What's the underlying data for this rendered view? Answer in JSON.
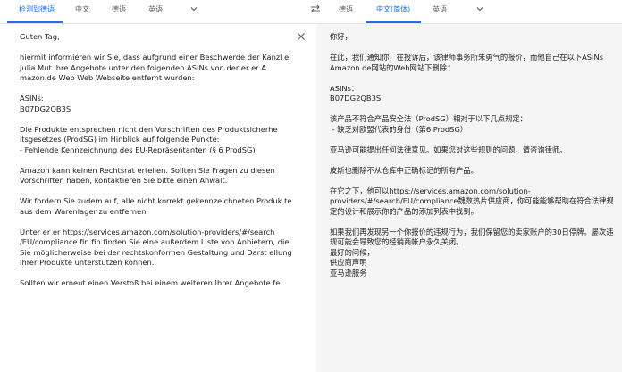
{
  "source_tabs": [
    {
      "label": "检测到德语",
      "active": true
    },
    {
      "label": "中文",
      "active": false
    },
    {
      "label": "德语",
      "active": false
    },
    {
      "label": "英语",
      "active": false
    }
  ],
  "target_tabs": [
    {
      "label": "德语",
      "active": false
    },
    {
      "label": "中文(简体)",
      "active": true
    },
    {
      "label": "英语",
      "active": false
    }
  ],
  "source_text": "Guten Tag,\n\nhiermit informieren wir Sie, dass aufgrund einer Beschwerde der Kanzl ei Julia Mut Ihre Angebote unter den folgenden ASINs von der er er A mazon.de Web Web Webseite entfernt wurden:\n\nASINs:\nB07DG2QB3S\n\nDie Produkte entsprechen nicht den Vorschriften des Produktsicherhe itsgesetzes (ProdSG) im Hinblick auf folgende Punkte:\n- Fehlende Kennzeichnung des EU-Repräsentanten (§ 6 ProdSG)\n\nAmazon kann keinen Rechtsrat erteilen. Sollten Sie Fragen zu diesen Vorschriften haben, kontaktieren Sie bitte einen Anwalt.\n\nWir fordern Sie zudem auf, alle nicht korrekt gekennzeichneten Produk te aus dem Warenlager zu entfernen.\n\nUnter er er https://services.amazon.com/solution-providers/#/search /EU/compliance fin fin finden Sie eine außerdem Liste von Anbietern, die Sie möglicherweise bei der rechtskonformen Gestaltung und Darst ellung Ihrer Produkte unterstützen können.\n\nSollten wir erneut einen Verstoß bei einem weiteren Ihrer Angebote fe",
  "target_text": "你好，\n\n在此，我们通知你，在投诉后，该律师事务所朱勇气的报价，而他自己在以下ASINs Amazon.de网站的Web网站下删除：\n\nASINs：\nB07DG2QB3S\n\n该产品不符合产品安全法（ProdSG）相对于以下几点规定：\n - 缺乏对欧盟代表的身份（第6 ProdSG）\n\n亚马逊可能提出任何法律意见。如果您对这些规则的问题，请咨询律师。\n\n皮斯也删除不从仓库中正确标记的所有产品。\n\n在它之下，他可以https://services.amazon.com/solution-providers/#/search/EU/compliance魏数热片供应商，你可能能够帮助在符合法律规定的设计和展示你的产品的添加列表中找到。\n\n如果我们再发现另一个你报价的违规行为，我们保留您的卖家账户的30日停牌。屡次违规可能会导致您的经销商帐户永久关闭。\n最好的问候，\n供应商声明\n亚马逊服务",
  "icons": {
    "swap": "swap-arrows-icon",
    "chevron": "chevron-down-icon",
    "close": "close-icon"
  },
  "colors": {
    "accent": "#1a73e8",
    "target_panel_bg": "#f5f5f5",
    "tab_text": "#5f6368"
  }
}
